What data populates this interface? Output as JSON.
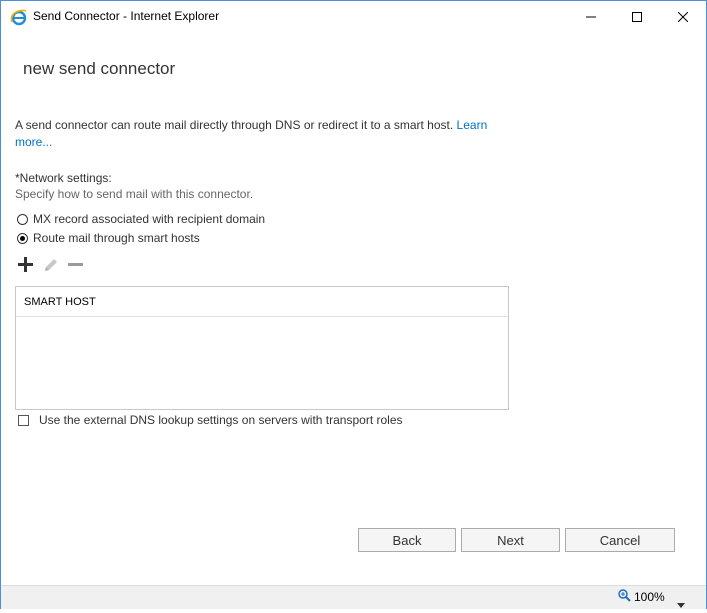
{
  "window": {
    "title": "Send Connector - Internet Explorer",
    "controls": {
      "minimize": "minimize",
      "maximize": "maximize",
      "close": "close"
    }
  },
  "page": {
    "heading": "new send connector",
    "intro_text": "A send connector can route mail directly through DNS or redirect it to a smart host. ",
    "learn_more": "Learn more...",
    "network_label": "*Network settings:",
    "network_desc": "Specify how to send mail with this connector.",
    "radio_mx": "MX record associated with recipient domain",
    "radio_smarthost": "Route mail through smart hosts",
    "selected_radio": "radio_smarthost",
    "grid_header": "SMART HOST",
    "external_dns": "Use the external DNS lookup settings on servers with transport roles"
  },
  "buttons": {
    "back": "Back",
    "next": "Next",
    "cancel": "Cancel"
  },
  "status": {
    "zoom": "100%"
  },
  "colors": {
    "link": "#0072c6",
    "frame": "#4a90d9"
  }
}
